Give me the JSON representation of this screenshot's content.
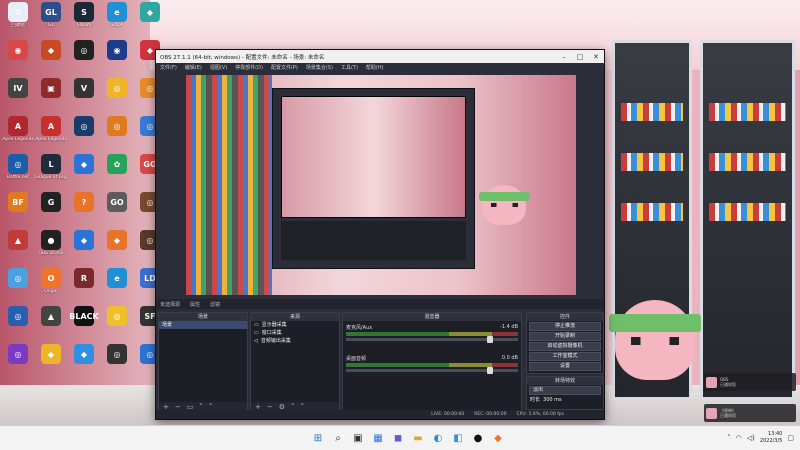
{
  "desktop": {
    "icons": [
      {
        "label": "回收站",
        "glyph": "♻",
        "color": "#e7eef6"
      },
      {
        "label": "GL",
        "glyph": "GL",
        "color": "#2b4e8c"
      },
      {
        "label": "Steam",
        "glyph": "S",
        "color": "#1b2838"
      },
      {
        "label": "Edge",
        "glyph": "e",
        "color": "#1f8fd6"
      },
      {
        "label": "",
        "glyph": "◆",
        "color": "#2fa6a0"
      },
      {
        "label": "",
        "glyph": "◉",
        "color": "#d94848"
      },
      {
        "label": "",
        "glyph": "◆",
        "color": "#c74a24"
      },
      {
        "label": "",
        "glyph": "◎",
        "color": "#222"
      },
      {
        "label": "",
        "glyph": "◉",
        "color": "#1c3c8a"
      },
      {
        "label": "",
        "glyph": "◆",
        "color": "#d0343c"
      },
      {
        "label": "",
        "glyph": "IV",
        "color": "#444"
      },
      {
        "label": "",
        "glyph": "▣",
        "color": "#8e2a2a"
      },
      {
        "label": "",
        "glyph": "V",
        "color": "#333"
      },
      {
        "label": "",
        "glyph": "◎",
        "color": "#f0b429"
      },
      {
        "label": "",
        "glyph": "◎",
        "color": "#e88b2b"
      },
      {
        "label": "Apex Legends",
        "glyph": "A",
        "color": "#b0282f"
      },
      {
        "label": "Apex Legends",
        "glyph": "A",
        "color": "#c7302f"
      },
      {
        "label": "",
        "glyph": "◎",
        "color": "#1a3c6b"
      },
      {
        "label": "",
        "glyph": "◎",
        "color": "#e07a1f"
      },
      {
        "label": "",
        "glyph": "◎",
        "color": "#3a7bd5"
      },
      {
        "label": "Battle.net",
        "glyph": "◎",
        "color": "#1b5ea8"
      },
      {
        "label": "League of Legends",
        "glyph": "L",
        "color": "#1e2d3d"
      },
      {
        "label": "",
        "glyph": "◆",
        "color": "#2b74d6"
      },
      {
        "label": "",
        "glyph": "✿",
        "color": "#25a35a"
      },
      {
        "label": "",
        "glyph": "GG",
        "color": "#d94848"
      },
      {
        "label": "",
        "glyph": "BF",
        "color": "#e07a1f"
      },
      {
        "label": "",
        "glyph": "G",
        "color": "#222"
      },
      {
        "label": "",
        "glyph": "?",
        "color": "#e8742b"
      },
      {
        "label": "",
        "glyph": "GO",
        "color": "#5c5c5c"
      },
      {
        "label": "",
        "glyph": "◎",
        "color": "#7a4a2a"
      },
      {
        "label": "",
        "glyph": "▲",
        "color": "#c23b3b"
      },
      {
        "label": "OBS Studio",
        "glyph": "●",
        "color": "#222"
      },
      {
        "label": "",
        "glyph": "◆",
        "color": "#2b74d6"
      },
      {
        "label": "",
        "glyph": "◆",
        "color": "#e8742b"
      },
      {
        "label": "",
        "glyph": "◎",
        "color": "#5a3a2a"
      },
      {
        "label": "",
        "glyph": "◎",
        "color": "#4aa0e0"
      },
      {
        "label": "Origin",
        "glyph": "O",
        "color": "#f0732b"
      },
      {
        "label": "",
        "glyph": "R",
        "color": "#7a2a2a"
      },
      {
        "label": "",
        "glyph": "e",
        "color": "#1f8fd6"
      },
      {
        "label": "",
        "glyph": "LD",
        "color": "#3b6fd1"
      },
      {
        "label": "",
        "glyph": "◎",
        "color": "#2a5fb0"
      },
      {
        "label": "",
        "glyph": "▲",
        "color": "#444"
      },
      {
        "label": "",
        "glyph": "BLACK",
        "color": "#111"
      },
      {
        "label": "",
        "glyph": "◎",
        "color": "#f0c02b"
      },
      {
        "label": "",
        "glyph": "SF",
        "color": "#333"
      },
      {
        "label": "",
        "glyph": "◎",
        "color": "#7a3ac4"
      },
      {
        "label": "",
        "glyph": "◆",
        "color": "#f0b429"
      },
      {
        "label": "",
        "glyph": "◆",
        "color": "#2f8fe0"
      },
      {
        "label": "",
        "glyph": "◎",
        "color": "#333"
      },
      {
        "label": "",
        "glyph": "◎",
        "color": "#2b74d6"
      }
    ]
  },
  "obs": {
    "title": "OBS 27.1.1 (64-bit, windows) - 配置文件: 未命名 - 场景: 未命名",
    "menu": [
      "文件(F)",
      "编辑(E)",
      "视图(V)",
      "停靠部件(D)",
      "配置文件(P)",
      "场景集合(S)",
      "工具(T)",
      "帮助(H)"
    ],
    "toolbar": {
      "source_label": "未选择源",
      "props": "属性",
      "filters": "滤镜"
    },
    "scenes_panel": {
      "title": "场景",
      "items": [
        "场景"
      ]
    },
    "sources_panel": {
      "title": "来源",
      "items": [
        "显示器采集",
        "窗口采集",
        "音频输出采集"
      ]
    },
    "mixer": {
      "title": "混音器",
      "channels": [
        {
          "name": "麦克风/Aux",
          "db": "-1.4 dB"
        },
        {
          "name": "桌面音频",
          "db": "0.0 dB"
        }
      ]
    },
    "controls": {
      "title": "控件",
      "buttons": [
        "停止推流",
        "开始录制",
        "启动虚拟摄像机",
        "工作室模式",
        "设置",
        "退出"
      ]
    },
    "transitions": {
      "title": "转场特效",
      "type": "淡出",
      "duration_label": "时长",
      "duration": "300 ms"
    },
    "status": {
      "live": "LIVE: 00:00:00",
      "rec": "REC: 00:00:00",
      "cpu": "CPU: 5.9%, 60.00 fps"
    }
  },
  "notifications": [
    {
      "title": "OBS",
      "text": "已通知您"
    },
    {
      "title": "《原神》",
      "text": "已通知您"
    }
  ],
  "taskbar": {
    "apps": [
      "start",
      "search",
      "task-view",
      "widgets",
      "chat",
      "explorer",
      "edge",
      "store",
      "obs",
      "app"
    ],
    "time": "13:40",
    "date": "2022/3/5"
  }
}
